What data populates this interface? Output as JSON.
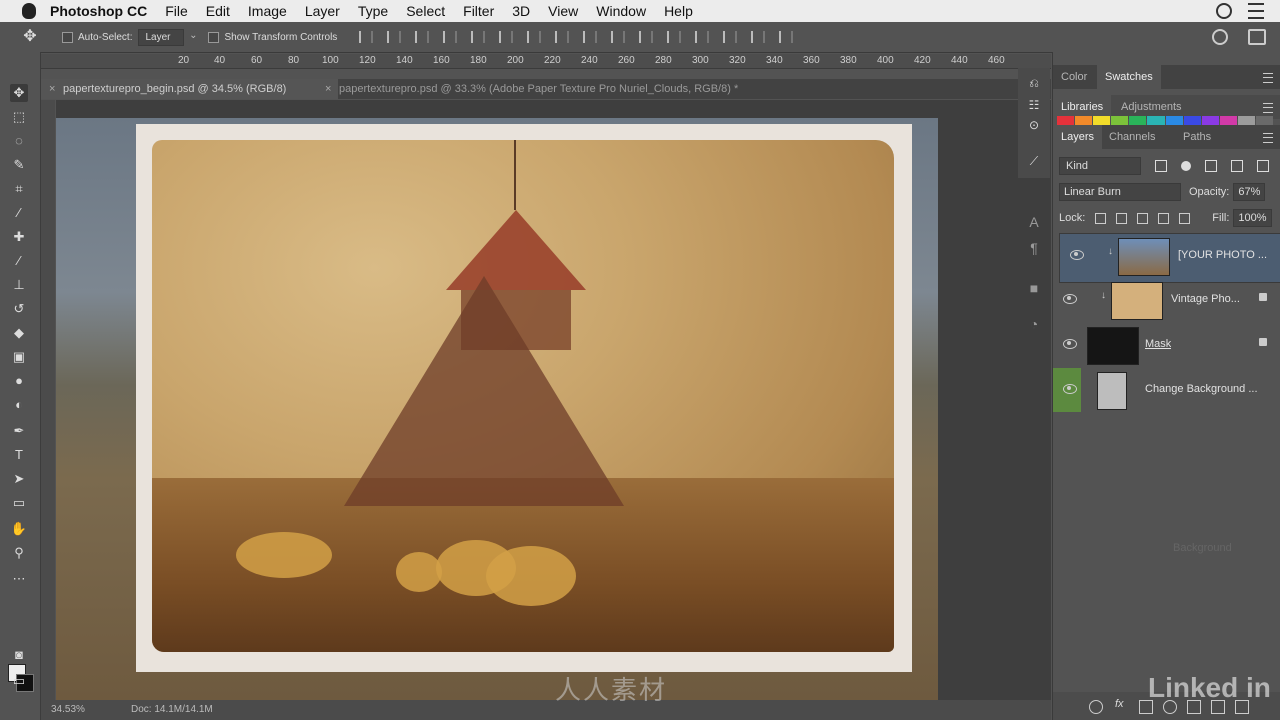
{
  "menubar": {
    "app": "Photoshop CC",
    "items": [
      "File",
      "Edit",
      "Image",
      "Layer",
      "Type",
      "Select",
      "Filter",
      "3D",
      "View",
      "Window",
      "Help"
    ]
  },
  "options": {
    "auto_select_label": "Auto-Select:",
    "auto_select_value": "Layer",
    "show_transform_label": "Show Transform Controls"
  },
  "ruler": {
    "ticks": [
      "20",
      "40",
      "60",
      "80",
      "100",
      "120",
      "140",
      "160",
      "180",
      "200",
      "220",
      "240",
      "260",
      "280",
      "300",
      "320",
      "340",
      "360",
      "380",
      "400",
      "420",
      "440",
      "460"
    ]
  },
  "tabs": {
    "active": "papertexturepro_begin.psd @ 34.5% (RGB/8)",
    "inactive": "papertexturepro.psd @ 33.3% (Adobe Paper Texture Pro Nuriel_Clouds, RGB/8) *"
  },
  "status": {
    "zoom": "34.53%",
    "doc": "Doc: 14.1M/14.1M"
  },
  "panels": {
    "color_tabs": [
      "Color",
      "Swatches"
    ],
    "lib_tabs": [
      "Libraries",
      "Adjustments"
    ],
    "layer_tabs": [
      "Layers",
      "Channels",
      "Paths"
    ],
    "filter_kind": "Kind",
    "blend_mode": "Linear Burn",
    "opacity_label": "Opacity:",
    "opacity_value": "67%",
    "lock_label": "Lock:",
    "fill_label": "Fill:",
    "fill_value": "100%",
    "layers": [
      {
        "name": "[YOUR PHOTO ..."
      },
      {
        "name": "Vintage Pho..."
      },
      {
        "name": "Mask"
      },
      {
        "name": "Change Background ..."
      }
    ],
    "ghost_background": "Background",
    "fx_label": "fx"
  },
  "swatch_colors": [
    "#e5323b",
    "#f28a2a",
    "#f2dc2a",
    "#7cc23a",
    "#2ab45a",
    "#2ab4b4",
    "#2a8ae5",
    "#3a4ae5",
    "#8a3ae5",
    "#d23aa8",
    "#9c9c9c",
    "#6a6a6a"
  ],
  "watermark": "人人素材",
  "linkedin": "Linked in"
}
